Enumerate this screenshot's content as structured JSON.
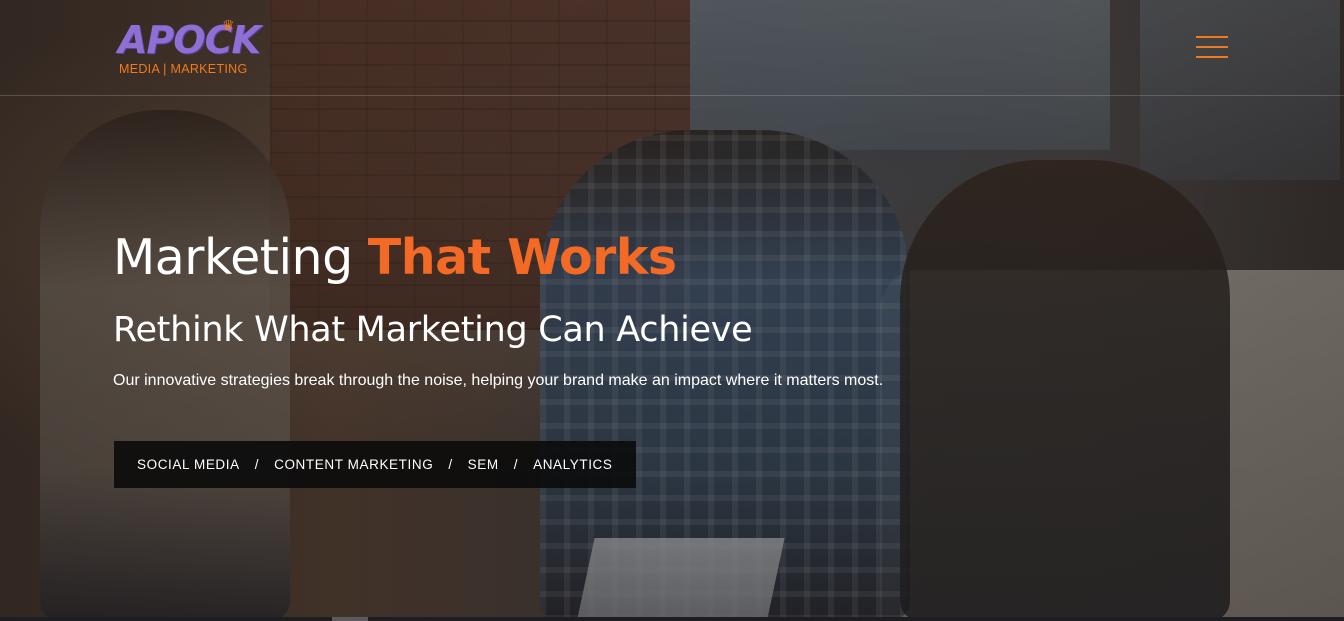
{
  "header": {
    "logo_word": "APOCK",
    "logo_tagline": "MEDIA | MARKETING",
    "menu_icon": "hamburger-icon"
  },
  "hero": {
    "headline_plain": "Marketing ",
    "headline_accent": "That Works",
    "subheadline": "Rethink What Marketing Can Achieve",
    "description": "Our innovative strategies break through the noise, helping your brand make an impact where it matters most.",
    "services": [
      "SOCIAL MEDIA",
      "CONTENT MARKETING",
      "SEM",
      "ANALYTICS"
    ],
    "separator": "/"
  },
  "colors": {
    "accent": "#f26a25",
    "logo_purple": "#8e6fd3",
    "services_bg": "#0c0c0c"
  }
}
